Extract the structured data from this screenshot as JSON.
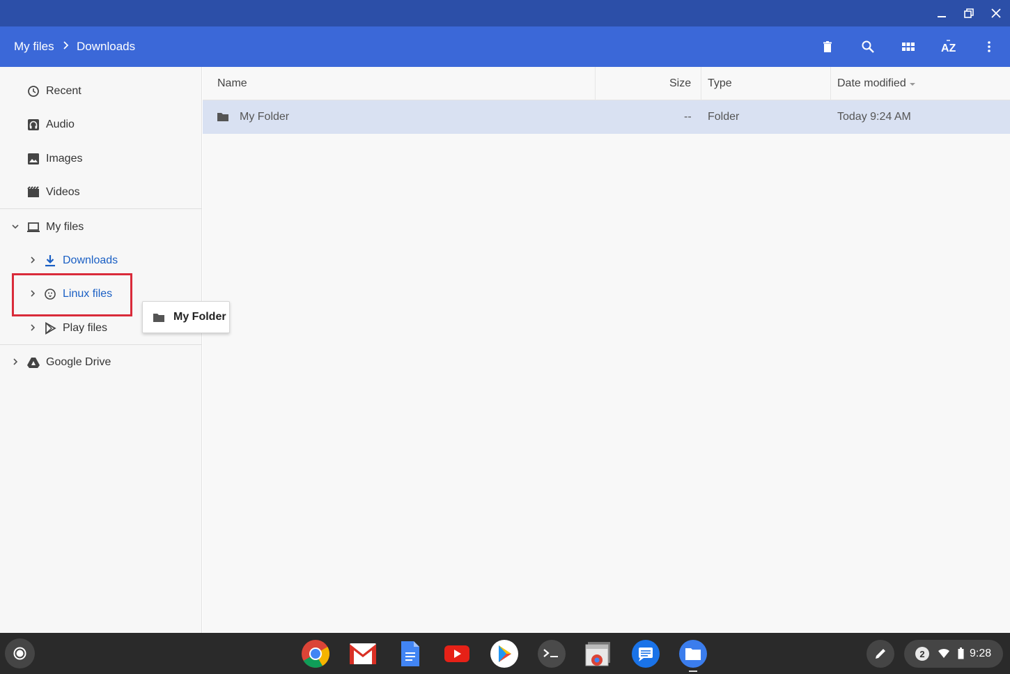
{
  "toolbar": {
    "crumb_root": "My files",
    "crumb_current": "Downloads"
  },
  "sidebar": {
    "items": [
      {
        "label": "Recent",
        "icon": "clock-icon"
      },
      {
        "label": "Audio",
        "icon": "headphones-icon"
      },
      {
        "label": "Images",
        "icon": "image-icon"
      },
      {
        "label": "Videos",
        "icon": "film-icon"
      },
      {
        "label": "My files",
        "icon": "laptop-icon"
      },
      {
        "label": "Downloads",
        "icon": "download-icon"
      },
      {
        "label": "Linux files",
        "icon": "linux-penguin-icon"
      },
      {
        "label": "Play files",
        "icon": "play-store-icon"
      },
      {
        "label": "Google Drive",
        "icon": "google-drive-icon"
      }
    ]
  },
  "drag": {
    "label": "My Folder"
  },
  "table": {
    "columns": [
      "Name",
      "Size",
      "Type",
      "Date modified"
    ],
    "rows": [
      {
        "name": "My Folder",
        "size": "--",
        "type": "Folder",
        "date": "Today 9:24 AM"
      }
    ]
  },
  "shelf": {
    "apps": [
      "chrome-icon",
      "gmail-icon",
      "docs-icon",
      "youtube-icon",
      "play-store-icon",
      "terminal-icon",
      "chrome-browser-icon",
      "messages-icon",
      "files-icon"
    ],
    "notification_count": "2",
    "time": "9:28"
  },
  "colors": {
    "titlebar": "#2c4fa8",
    "toolbar": "#3b68d8",
    "selected_row": "#d9e1f2",
    "highlight_box": "#d92b3a",
    "link_blue": "#1a5fc4"
  }
}
